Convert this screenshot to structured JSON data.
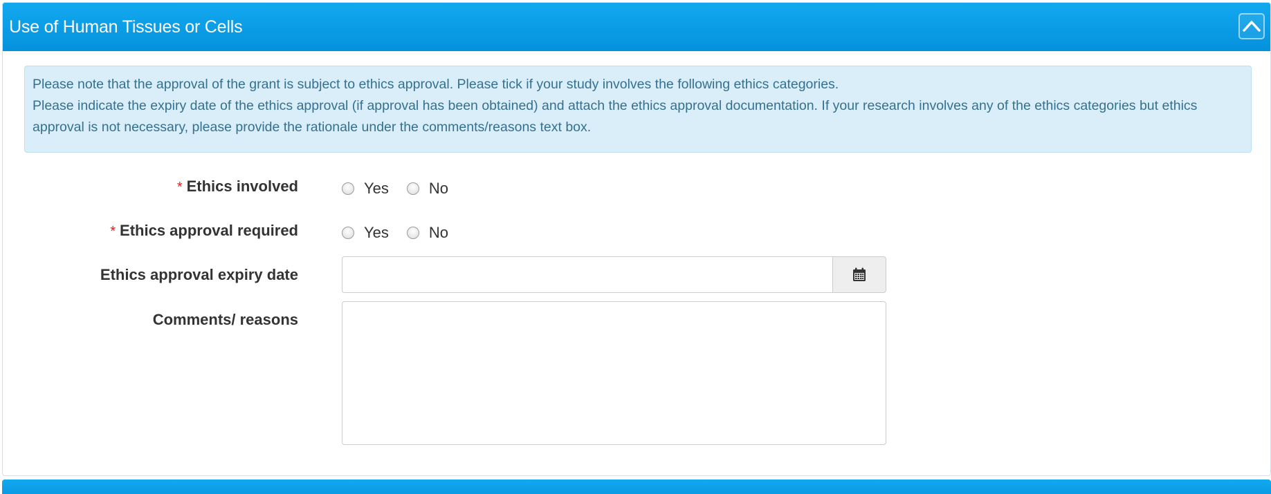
{
  "panel": {
    "title": "Use of Human Tissues or Cells",
    "collapse_icon": "chevron-up-icon"
  },
  "info": {
    "line1": "Please note that the approval of the grant is subject to ethics approval. Please tick if your study involves the following ethics categories.",
    "line2": "Please indicate the expiry date of the ethics approval (if approval has been obtained) and attach the ethics approval documentation. If your research involves any of the ethics categories but ethics approval is not necessary, please provide the rationale under the comments/reasons text box."
  },
  "form": {
    "required_marker": "*",
    "ethics_involved": {
      "label": "Ethics involved",
      "options": [
        "Yes",
        "No"
      ],
      "selected": null
    },
    "ethics_approval_required": {
      "label": "Ethics approval required",
      "options": [
        "Yes",
        "No"
      ],
      "selected": null
    },
    "expiry_date": {
      "label": "Ethics approval expiry date",
      "value": "",
      "button_icon": "calendar-icon"
    },
    "comments": {
      "label": "Comments/ reasons",
      "value": ""
    }
  },
  "colors": {
    "header_blue": "#0a9be4",
    "info_bg": "#d9eef8",
    "info_text": "#35708f",
    "required_red": "#e02020"
  }
}
